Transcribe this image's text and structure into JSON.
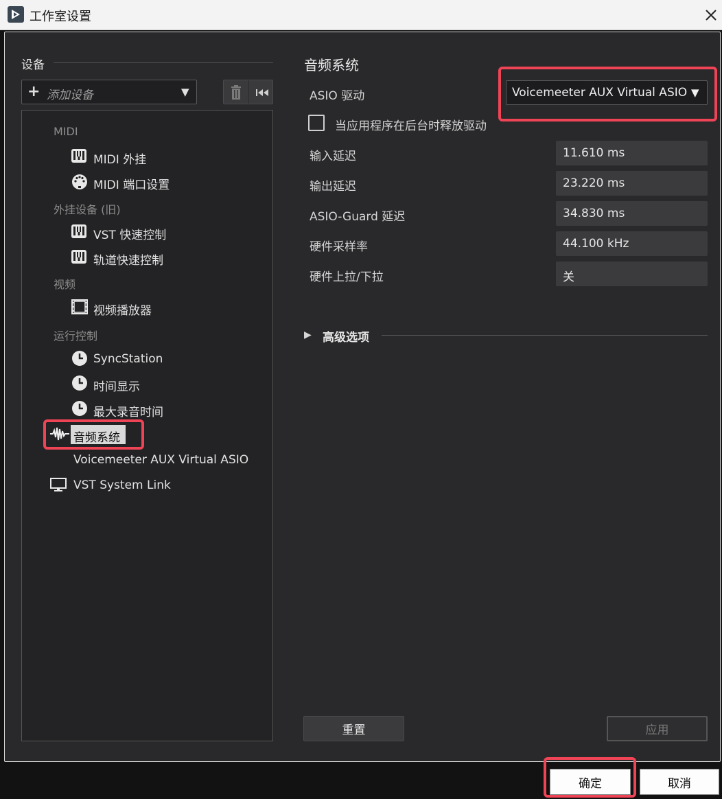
{
  "window": {
    "title": "工作室设置"
  },
  "left_panel": {
    "section_title": "设备",
    "add_device_label": "添加设备",
    "tree": {
      "cat_midi": "MIDI",
      "midi_plugin": "MIDI 外挂",
      "midi_port_setup": "MIDI 端口设置",
      "cat_plugin_legacy": "外挂设备 (旧)",
      "vst_quick_controls": "VST 快速控制",
      "track_quick_controls": "轨道快速控制",
      "cat_video": "视频",
      "video_player": "视频播放器",
      "cat_transport": "运行控制",
      "syncstation": "SyncStation",
      "time_display": "时间显示",
      "max_record_time": "最大录音时间",
      "audio_system": "音频系统",
      "asio_driver_item": "Voicemeeter AUX Virtual ASIO",
      "vst_system_link": "VST System Link"
    }
  },
  "right_panel": {
    "title": "音频系统",
    "asio_driver_label": "ASIO 驱动",
    "asio_driver_value": "Voicemeeter AUX Virtual ASIO",
    "release_driver_label": "当应用程序在后台时释放驱动",
    "release_driver_checked": false,
    "rows": {
      "input_latency_label": "输入延迟",
      "input_latency_value": "11.610 ms",
      "output_latency_label": "输出延迟",
      "output_latency_value": "23.220 ms",
      "asio_guard_label": "ASIO-Guard 延迟",
      "asio_guard_value": "34.830 ms",
      "sample_rate_label": "硬件采样率",
      "sample_rate_value": "44.100 kHz",
      "pulldown_label": "硬件上拉/下拉",
      "pulldown_value": "关"
    },
    "advanced_label": "高级选项",
    "reset_label": "重置",
    "apply_label": "应用"
  },
  "footer": {
    "ok_label": "确定",
    "cancel_label": "取消"
  },
  "colors": {
    "highlight": "#ee4455",
    "panel_bg": "#29292b",
    "selection_bg": "#d9d9d9"
  }
}
